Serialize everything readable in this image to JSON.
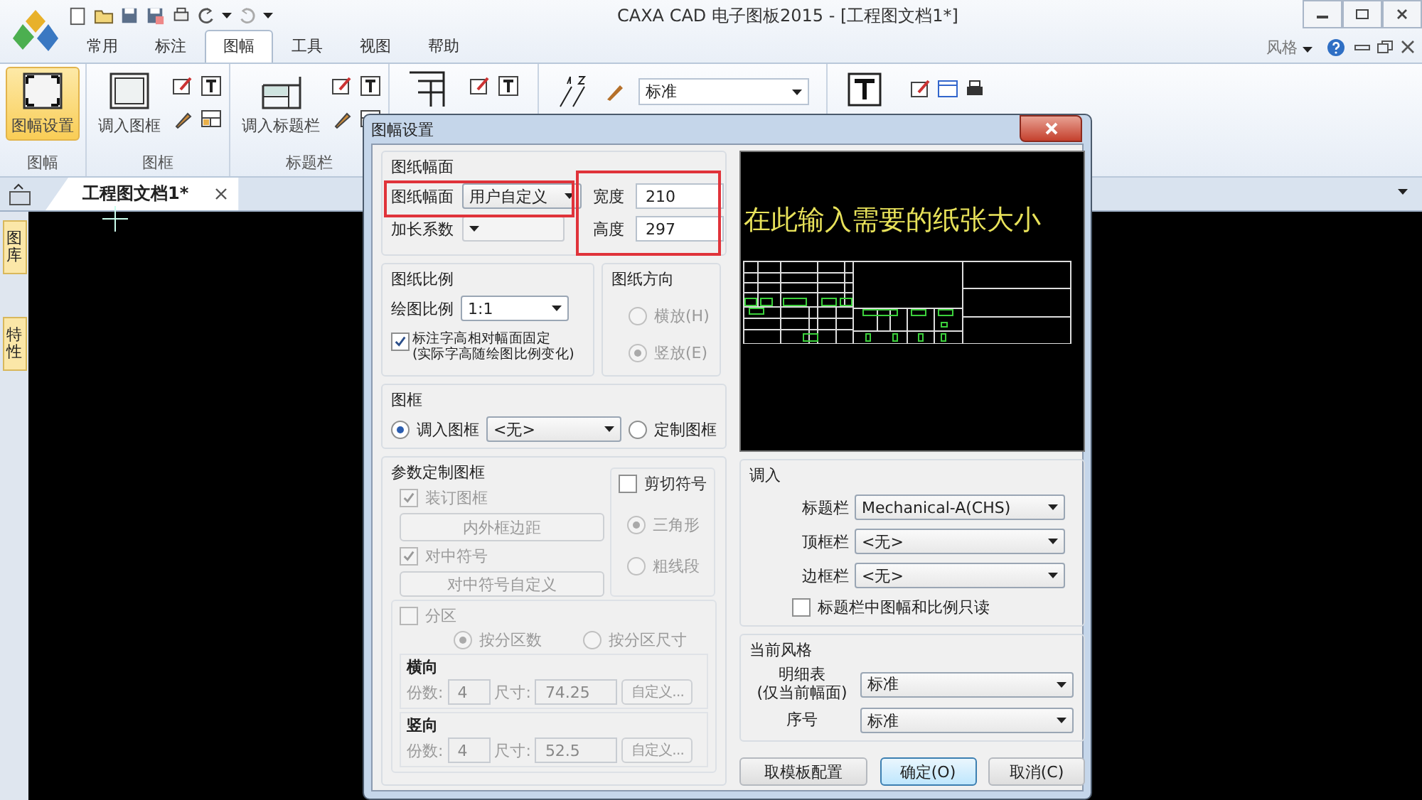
{
  "window": {
    "title": "CAXA CAD 电子图板2015 - [工程图文档1*]"
  },
  "ribbon_tabs": [
    {
      "label": "常用",
      "selected": false
    },
    {
      "label": "标注",
      "selected": false
    },
    {
      "label": "图幅",
      "selected": true
    },
    {
      "label": "工具",
      "selected": false
    },
    {
      "label": "视图",
      "selected": false
    },
    {
      "label": "帮助",
      "selected": false
    }
  ],
  "style_menu": "风格",
  "ribbon_groups": [
    {
      "label": "图幅",
      "button": {
        "label": "图幅设置",
        "selected": true
      }
    },
    {
      "label": "图框",
      "button": {
        "label": "调入图框",
        "selected": false
      }
    },
    {
      "label": "标题栏",
      "button": {
        "label": "调入标题栏",
        "selected": false
      }
    }
  ],
  "style_combo": {
    "value": "标准"
  },
  "document_tabs": [
    {
      "label": "工程图文档1*",
      "selected": true
    }
  ],
  "side_tabs": [
    {
      "label": "图库"
    },
    {
      "label": "特性"
    }
  ],
  "dialog": {
    "title": "图幅设置",
    "paper": {
      "title": "图纸幅面",
      "size_label": "图纸幅面",
      "size_value": "用户自定义",
      "extend_label": "加长系数",
      "extend_disabled": true,
      "width_label": "宽度",
      "width_value": "210",
      "height_label": "高度",
      "height_value": "297"
    },
    "scale": {
      "title": "图纸比例",
      "label": "绘图比例",
      "value": "1:1",
      "fixed_text_height": {
        "label": "标注字高相对幅面固定\n(实际字高随绘图比例变化)",
        "checked": true
      }
    },
    "orientation": {
      "title": "图纸方向",
      "disabled": true,
      "options": [
        {
          "label": "横放(H)",
          "selected": false
        },
        {
          "label": "竖放(E)",
          "selected": true
        }
      ]
    },
    "frame": {
      "title": "图框",
      "value": "<无>",
      "options": [
        {
          "label": "调入图框",
          "selected": true
        },
        {
          "label": "定制图框",
          "selected": false
        }
      ]
    },
    "custom_frame": {
      "title": "参数定制图框",
      "disabled": true,
      "binding": {
        "label": "装订图框",
        "checked": true
      },
      "margin_button": "内外框边距",
      "center_mark": {
        "label": "对中符号",
        "checked": true
      },
      "center_button": "对中符号自定义",
      "cut_mark": {
        "label": "剪切符号",
        "checked": false,
        "options": [
          {
            "label": "三角形",
            "selected": true
          },
          {
            "label": "粗线段",
            "selected": false
          }
        ]
      },
      "zoning": {
        "label": "分区",
        "checked": false,
        "options": [
          {
            "label": "按分区数",
            "selected": true
          },
          {
            "label": "按分区尺寸",
            "selected": false
          }
        ],
        "directions": [
          {
            "title": "横向",
            "count_label": "份数:",
            "count": "4",
            "size_label": "尺寸:",
            "size": "74.25",
            "button": "自定义..."
          },
          {
            "title": "竖向",
            "count_label": "份数:",
            "count": "4",
            "size_label": "尺寸:",
            "size": "52.5",
            "button": "自定义..."
          }
        ]
      }
    },
    "import": {
      "title": "调入",
      "rows": [
        {
          "label": "标题栏",
          "value": "Mechanical-A(CHS)"
        },
        {
          "label": "顶框栏",
          "value": "<无>"
        },
        {
          "label": "边框栏",
          "value": "<无>"
        }
      ],
      "readonly": {
        "label": "标题栏中图幅和比例只读",
        "checked": false
      }
    },
    "current_style": {
      "title": "当前风格",
      "rows": [
        {
          "label": "明细表\n(仅当前幅面)",
          "value": "标准"
        },
        {
          "label": "序号",
          "value": "标准"
        }
      ]
    },
    "buttons": [
      {
        "label": "取模板配置",
        "kind": "normal"
      },
      {
        "label": "确定(O)",
        "kind": "default"
      },
      {
        "label": "取消(C)",
        "kind": "normal"
      }
    ]
  },
  "annotation": {
    "note": "在此输入需要的纸张大小"
  }
}
